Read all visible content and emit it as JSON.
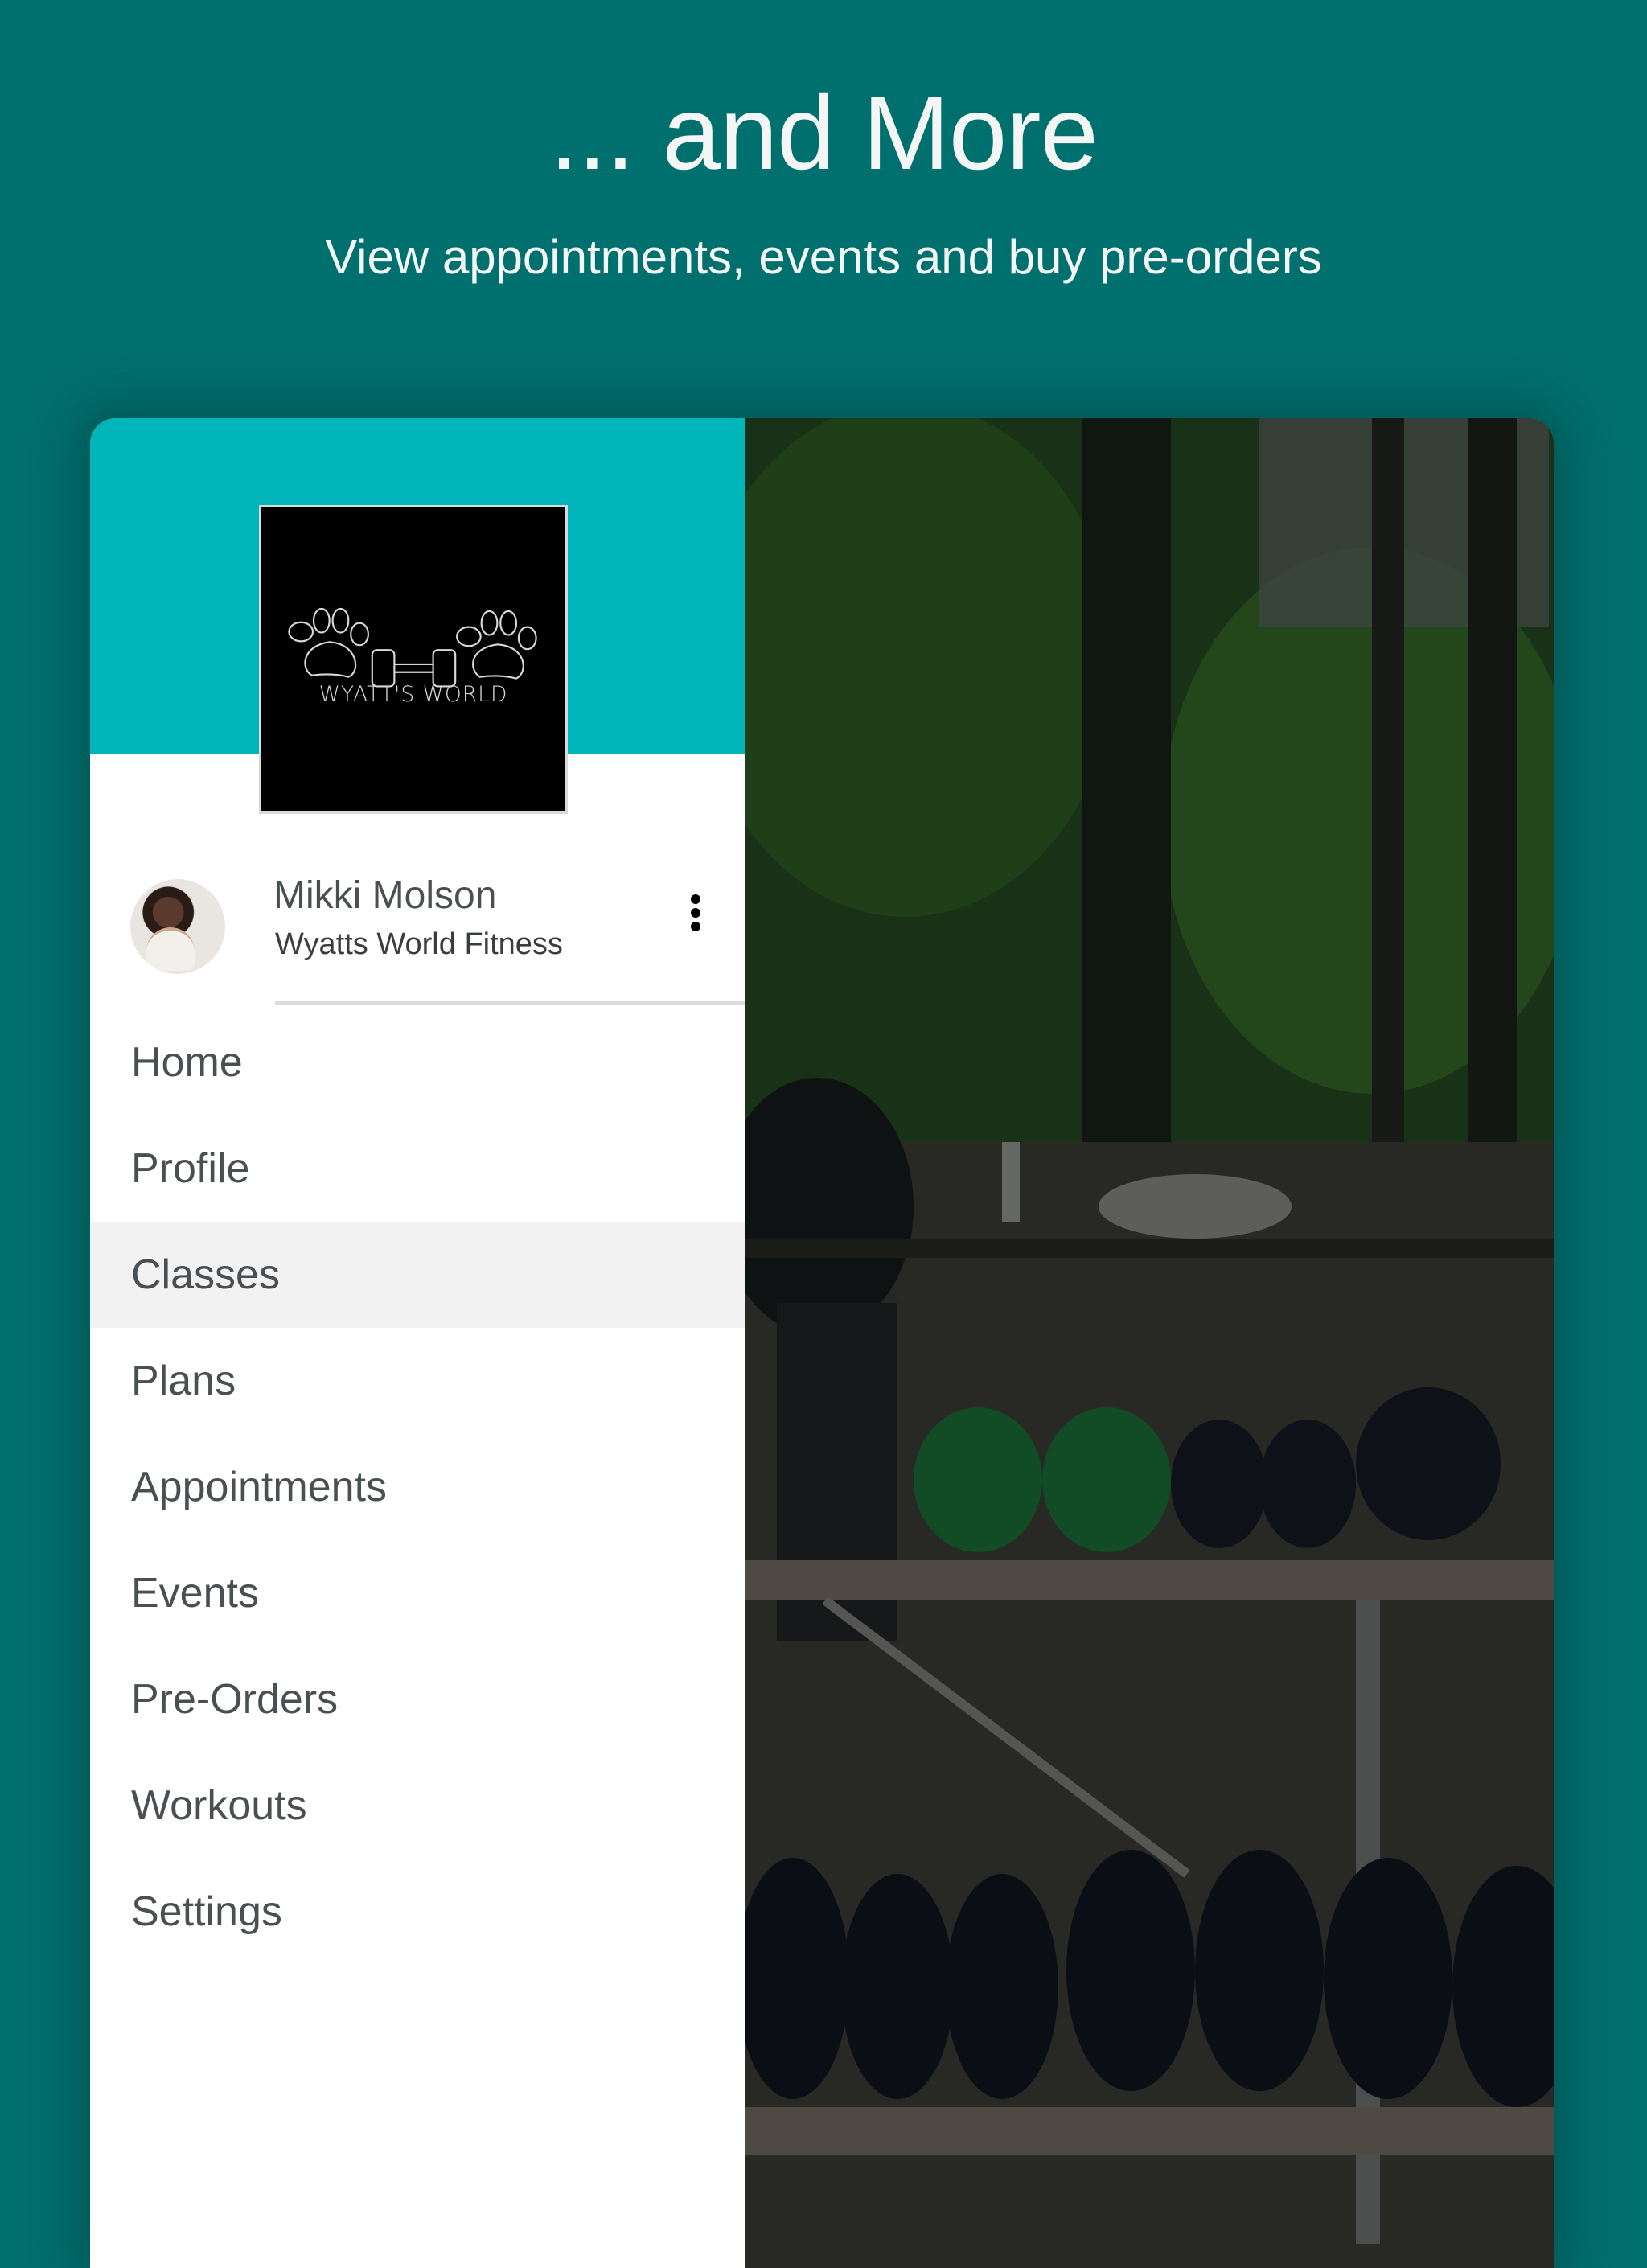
{
  "hero": {
    "title": "... and More",
    "subtitle": "View appointments, events and buy pre-orders"
  },
  "drawer": {
    "logo": {
      "text": "WYATT'S WORLD",
      "icon": "paw-dumbbell-logo"
    },
    "user": {
      "name": "Mikki Molson",
      "organization": "Wyatts World Fitness",
      "avatar": "user-avatar-photo",
      "more_icon": "more-vertical-icon"
    },
    "menu": [
      {
        "label": "Home",
        "active": false
      },
      {
        "label": "Profile",
        "active": false
      },
      {
        "label": "Classes",
        "active": true
      },
      {
        "label": "Plans",
        "active": false
      },
      {
        "label": "Appointments",
        "active": false
      },
      {
        "label": "Events",
        "active": false
      },
      {
        "label": "Pre-Orders",
        "active": false
      },
      {
        "label": "Workouts",
        "active": false
      },
      {
        "label": "Settings",
        "active": false
      }
    ]
  },
  "background_photo": {
    "description": "outdoor gym with dog, trees and dumbbell rack (dimmed behind drawer)"
  },
  "colors": {
    "page_background": "#00706e",
    "drawer_header": "#00b6ba",
    "menu_text": "#4a4f52",
    "active_item_background": "#f2f2f2",
    "title_text": "#f4f6f6"
  }
}
